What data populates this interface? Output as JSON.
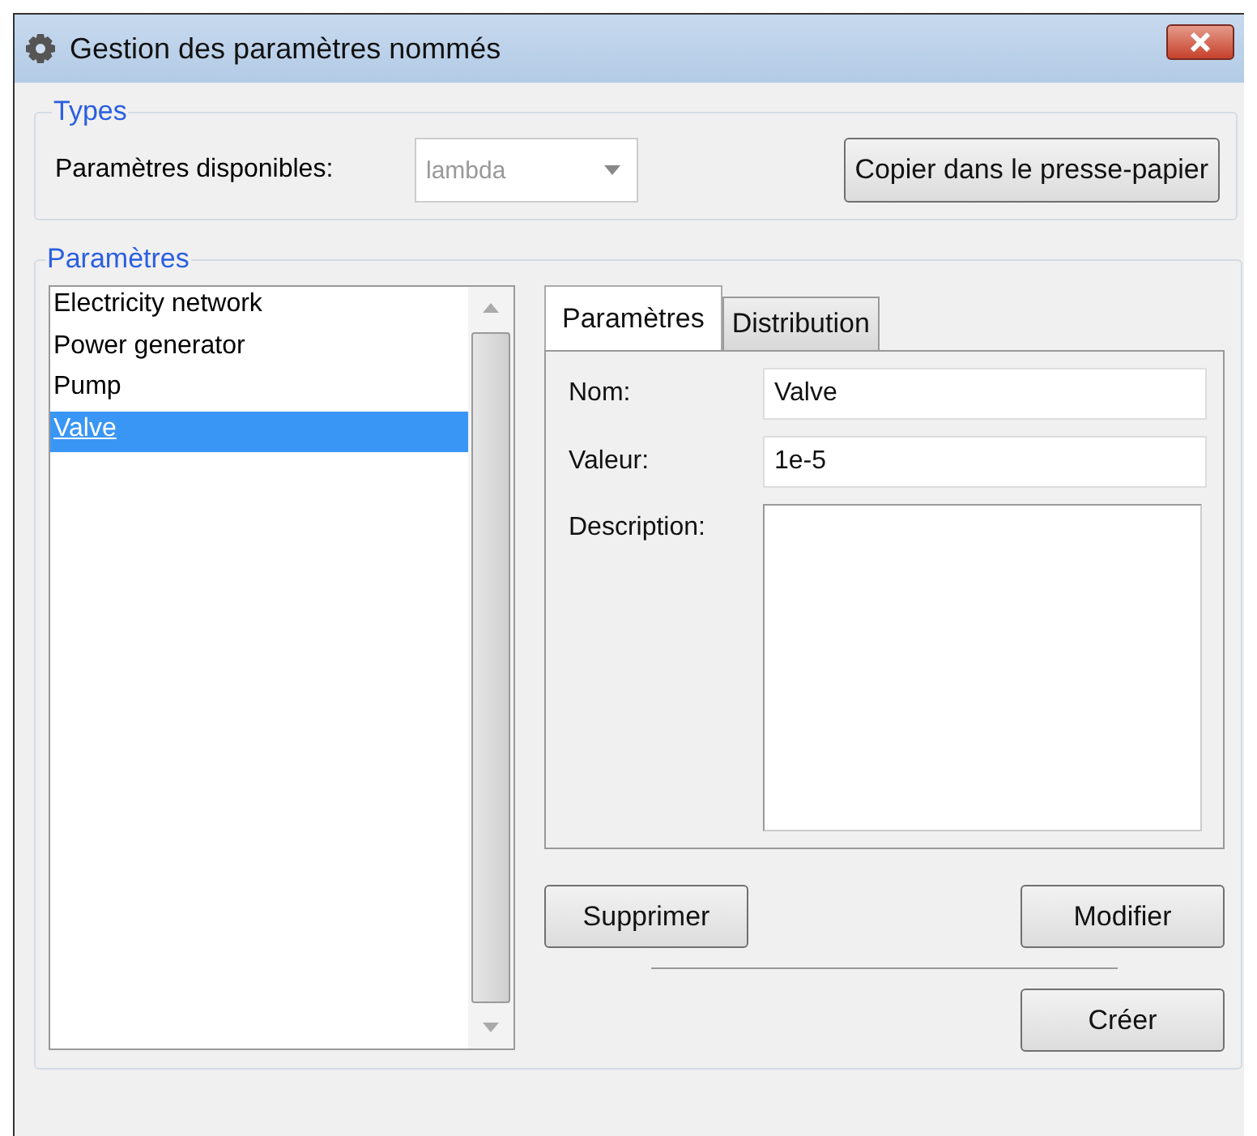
{
  "window": {
    "title": "Gestion des paramètres nommés"
  },
  "types": {
    "legend": "Types",
    "label": "Paramètres disponibles:",
    "combo": {
      "value": "lambda",
      "disabled": true
    },
    "copy_button": "Copier dans le presse-papier"
  },
  "parameters": {
    "legend": "Paramètres",
    "items": [
      {
        "label": "Electricity network",
        "selected": false
      },
      {
        "label": "Power generator",
        "selected": false
      },
      {
        "label": "Pump",
        "selected": false
      },
      {
        "label": "Valve",
        "selected": true
      }
    ],
    "tabs": [
      {
        "label": "Paramètres",
        "selected": true
      },
      {
        "label": "Distribution",
        "selected": false
      }
    ],
    "fields": [
      {
        "kind": "line",
        "label": "Nom:",
        "value": "Valve"
      },
      {
        "kind": "line",
        "label": "Valeur:",
        "value": "1e-5"
      },
      {
        "kind": "area",
        "label": "Description:"
      }
    ],
    "delete_button": "Supprimer",
    "modify_button": "Modifier",
    "create_button": "Créer"
  }
}
